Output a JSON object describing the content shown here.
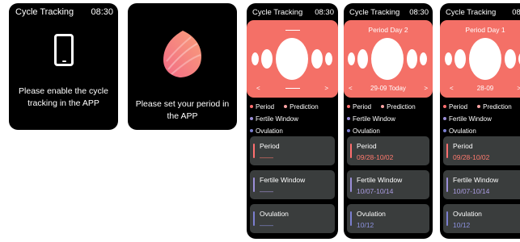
{
  "status": {
    "title": "Cycle Tracking",
    "time": "08:30"
  },
  "screen1": {
    "message": "Please enable the cycle tracking in the APP"
  },
  "screen2": {
    "message": "Please set your period in the APP"
  },
  "legend": {
    "period": "Period",
    "prediction": "Prediction",
    "fertile": "Fertile Window",
    "ovulation": "Ovulation"
  },
  "screen3": {
    "header": "",
    "nav": {
      "prev": "<",
      "date": "",
      "next": ">"
    },
    "cards": [
      {
        "title": "Period",
        "value": "——"
      },
      {
        "title": "Fertile Window",
        "value": "——"
      },
      {
        "title": "Ovulation",
        "value": "——"
      }
    ]
  },
  "screen4": {
    "header": "Period Day 2",
    "nav": {
      "prev": "<",
      "date": "29-09 Today",
      "next": ">"
    },
    "cards": [
      {
        "title": "Period",
        "value": "09/28-10/02"
      },
      {
        "title": "Fertile Window",
        "value": "10/07-10/14"
      },
      {
        "title": "Ovulation",
        "value": "10/12"
      }
    ]
  },
  "screen5": {
    "header": "Period Day 1",
    "nav": {
      "prev": "<",
      "date": "28-09",
      "next": ">"
    },
    "cards": [
      {
        "title": "Period",
        "value": "09/28-10/02"
      },
      {
        "title": "Fertile Window",
        "value": "10/07-10/14"
      },
      {
        "title": "Ovulation",
        "value": "10/12"
      }
    ]
  },
  "colors": {
    "screen_bg": "#000000",
    "panel": "#f47067",
    "card": "#3a3d3d",
    "period": "#ff6f6f",
    "prediction": "#f9a3a3",
    "fertile": "#9b8fd8",
    "ovulation": "#7b7fd0",
    "period_value": "#ff7a6e",
    "fertile_value": "#a99be0",
    "ovulation_value": "#8d92e0"
  },
  "icons": {
    "screen1": "smartphone-icon",
    "screen2": "leaf-logo-icon"
  }
}
